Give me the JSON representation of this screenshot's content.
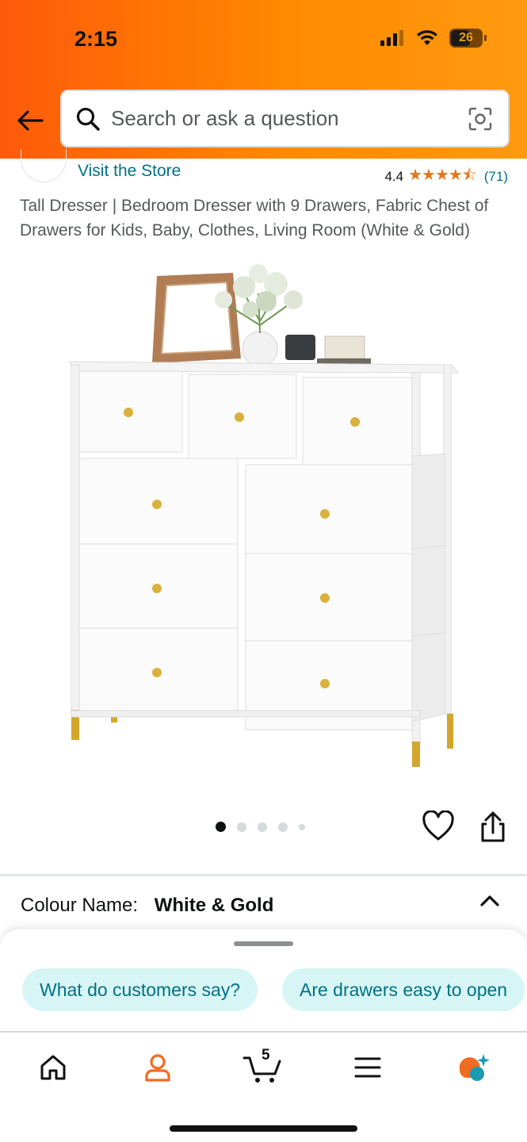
{
  "status_bar": {
    "time": "2:15",
    "battery": "26"
  },
  "search": {
    "placeholder": "Search or ask a question"
  },
  "store": {
    "link_text": "Visit the Store"
  },
  "rating": {
    "value": "4.4",
    "stars": "★★★★⯪",
    "count": "(71)"
  },
  "product": {
    "title": "Tall Dresser | Bedroom Dresser with 9 Drawers, Fabric Chest of Drawers for Kids, Baby, Clothes, Living Room (White & Gold)"
  },
  "carousel": {
    "total_images": 5,
    "active_index": 0
  },
  "colour": {
    "label": "Colour Name:",
    "value": "White & Gold"
  },
  "suggestions": [
    {
      "label": "What do customers say?"
    },
    {
      "label": "Are drawers easy to open"
    }
  ],
  "nav": {
    "cart_count": "5"
  },
  "colors": {
    "header_start": "#ff5a0a",
    "header_end": "#ff9a10",
    "link": "#007185",
    "star": "#de7921",
    "account": "#f26b21"
  }
}
